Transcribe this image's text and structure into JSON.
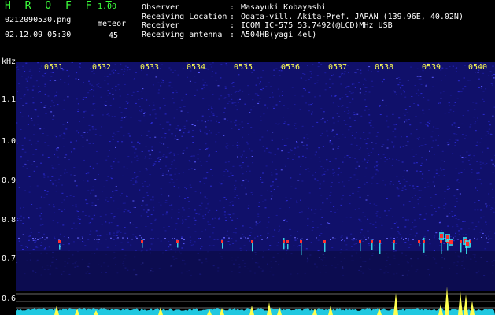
{
  "app": {
    "name": "H R O F F T",
    "version": "1.00"
  },
  "file": {
    "name": "0212090530.png",
    "datetime": "02.12.09 05:30"
  },
  "meteor": {
    "label": "meteor",
    "count": "45"
  },
  "info": [
    {
      "label": "Observer",
      "value": "Masayuki Kobayashi"
    },
    {
      "label": "Receiving Location",
      "value": "Ogata-vill. Akita-Pref. JAPAN (139.96E, 40.02N)"
    },
    {
      "label": "Receiver",
      "value": "ICOM IC-575 53.7492(@LCD)MHz USB"
    },
    {
      "label": "Receiving antenna",
      "value": "A504HB(yagi 4el)"
    }
  ],
  "y_axis": {
    "unit": "kHz",
    "ticks": [
      "1.1",
      "1.0",
      "0.9",
      "0.8",
      "0.7",
      "0.6"
    ]
  },
  "time_axis": {
    "ticks": [
      "0531",
      "0532",
      "0533",
      "0534",
      "0535",
      "0536",
      "0537",
      "0538",
      "0539",
      "0540"
    ]
  },
  "colors": {
    "background": "#10106a",
    "noise": "#2a2ad0",
    "echo_hot": "#ff3030",
    "echo_warm": "#40ffff",
    "timeline": "#ffff50",
    "logo": "#3cff3c"
  }
}
